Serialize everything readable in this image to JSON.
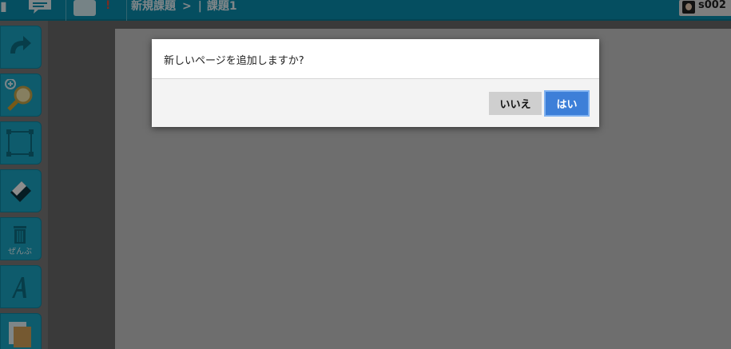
{
  "topbar": {
    "breadcrumb": {
      "root": "新規課題",
      "separator": ">",
      "divider": "|",
      "current": "課題1"
    },
    "user_id": "s002",
    "icons": [
      "menu-glyph-icon",
      "chat-icon",
      "photo-icon",
      "alert-icon"
    ]
  },
  "sidebar": {
    "tools": [
      {
        "name": "redo",
        "icon": "redo-icon"
      },
      {
        "name": "zoom",
        "icon": "zoom-icon"
      },
      {
        "name": "select",
        "icon": "select-rectangle-icon"
      },
      {
        "name": "eraser",
        "icon": "eraser-icon"
      },
      {
        "name": "clear-all",
        "icon": "trash-icon",
        "label": "ぜんぶ"
      },
      {
        "name": "text",
        "icon": "text-icon"
      },
      {
        "name": "page",
        "icon": "page-icon"
      }
    ]
  },
  "dialog": {
    "message": "新しいページを追加しますか?",
    "no_label": "いいえ",
    "yes_label": "はい"
  },
  "colors": {
    "toolbar": "#0a8fb0",
    "tool_button": "#1aa7c5",
    "yes_button": "#3d7fd8",
    "no_button": "#cfcfcf"
  }
}
